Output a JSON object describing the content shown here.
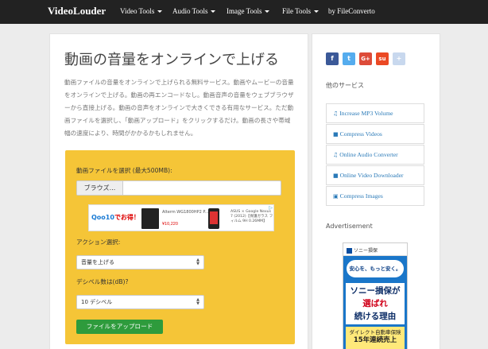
{
  "nav": {
    "brand": "VideoLouder",
    "items": [
      {
        "label": "Video Tools"
      },
      {
        "label": "Audio Tools"
      },
      {
        "label": "Image Tools"
      },
      {
        "label": "File Tools"
      },
      {
        "label": "by FileConverto"
      }
    ]
  },
  "main": {
    "title": "動画の音量をオンラインで上げる",
    "description": "動画ファイルの音量をオンラインで上げられる無料サービス。動画やムービーの音量をオンラインで上げる。動画の再エンコードなし。動画音声の音量をウェブブラウザーから直接上げる。動画の音声をオンラインで大きくできる有用なサービス。ただ動画ファイルを選択し、「動画アップロード」をクリックするだけ。動画の長さや帯域幅の速度により、時間がかかるかもしれません。",
    "form": {
      "file_label": "動画ファイルを選択 (最大500MB):",
      "browse_label": "ブラウズ...",
      "action_label": "アクション選択:",
      "action_value": "音量を上げる",
      "db_label": "デシベル数は(dB)?",
      "db_value": "10 デシベル",
      "upload_label": "ファイルをアップロード"
    },
    "ad": {
      "qoo10_text": "でお得！",
      "qoo10_brand": "Qoo10",
      "product1": "Alterm WG1800HP2 P...",
      "price1": "¥10,220",
      "product2": "ASUS × Google Nexus 7 (2012)【保護ガラス フィルム 9H 0.26MM】",
      "close": "▷"
    }
  },
  "side": {
    "social": [
      {
        "name": "facebook",
        "glyph": "f",
        "color": "#3b5998"
      },
      {
        "name": "twitter",
        "glyph": "t",
        "color": "#55acee"
      },
      {
        "name": "googleplus",
        "glyph": "G+",
        "color": "#dd4b39"
      },
      {
        "name": "stumbleupon",
        "glyph": "su",
        "color": "#eb4924"
      },
      {
        "name": "more",
        "glyph": "+",
        "color": "#c8d8ee"
      }
    ],
    "services_heading": "他のサービス",
    "links": [
      {
        "icon": "music-icon",
        "glyph": "♫",
        "label": "Increase MP3 Volume"
      },
      {
        "icon": "video-icon",
        "glyph": "■",
        "label": "Compress Videos"
      },
      {
        "icon": "music-icon",
        "glyph": "♫",
        "label": "Online Audio Converter"
      },
      {
        "icon": "video-icon",
        "glyph": "■",
        "label": "Online Video Downloader"
      },
      {
        "icon": "image-icon",
        "glyph": "▣",
        "label": "Compress Images"
      }
    ],
    "advertisement_heading": "Advertisement",
    "banner": {
      "logo": "ソニー損保",
      "bubble": "安心を、もっと安く。",
      "line1": "ソニー損保が",
      "line2": "選ばれ",
      "line3": "続ける理由",
      "sub1": "ダイレクト自動車保険",
      "sub2": "15年連続売上"
    }
  }
}
